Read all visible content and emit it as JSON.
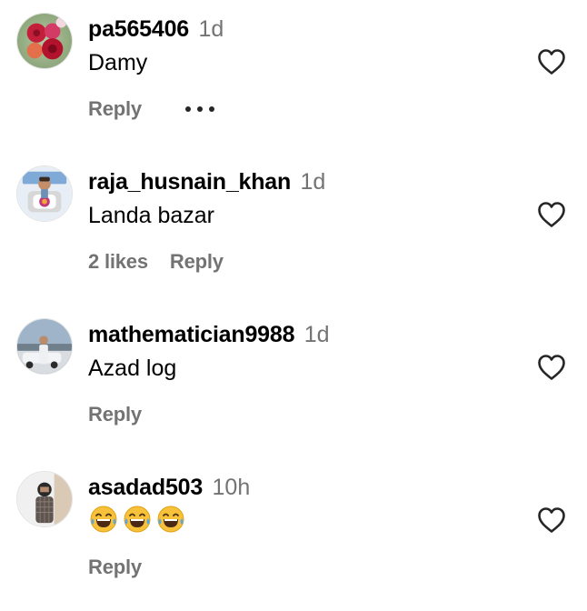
{
  "comments": [
    {
      "username": "pa565406",
      "time": "1d",
      "text": "Damy",
      "likes": "",
      "reply_label": "Reply",
      "has_more": true
    },
    {
      "username": "raja_husnain_khan",
      "time": "1d",
      "text": "Landa bazar",
      "likes": "2 likes",
      "reply_label": "Reply",
      "has_more": false
    },
    {
      "username": "mathematician9988",
      "time": "1d",
      "text": "Azad log",
      "likes": "",
      "reply_label": "Reply",
      "has_more": false
    },
    {
      "username": "asadad503",
      "time": "10h",
      "text": "😂😂😂",
      "emoji_count": 3,
      "likes": "",
      "reply_label": "Reply",
      "has_more": false
    }
  ],
  "icons": {
    "like": "heart-outline-icon",
    "more": "more-horizontal-icon"
  },
  "colors": {
    "text_primary": "#000000",
    "text_secondary": "#737373",
    "icon": "#262626",
    "background": "#ffffff"
  }
}
